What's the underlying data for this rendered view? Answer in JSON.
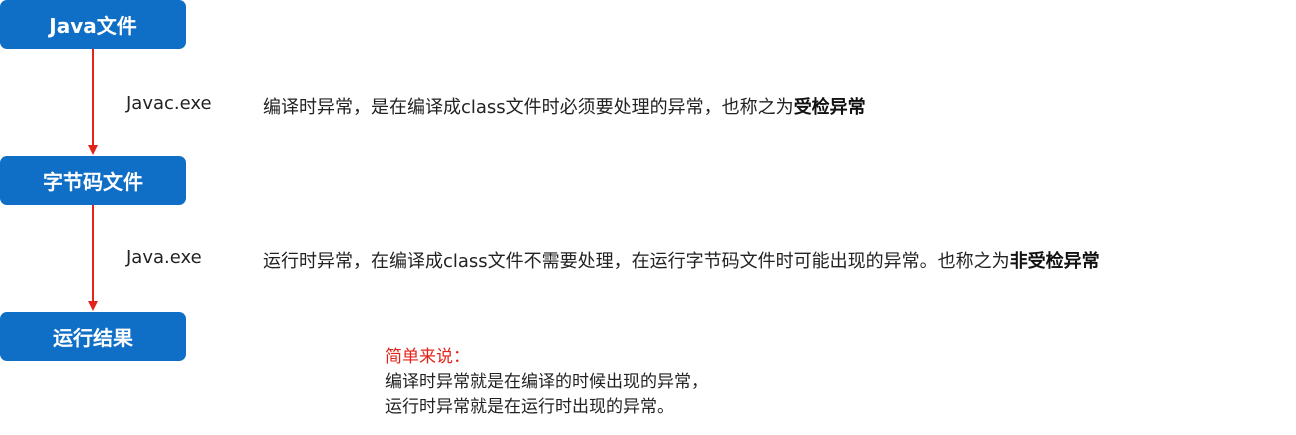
{
  "stages": [
    {
      "label": "Java文件"
    },
    {
      "label": "字节码文件"
    },
    {
      "label": "运行结果"
    }
  ],
  "transitions": [
    {
      "tool": "Javac.exe",
      "description": "编译时异常，是在编译成class文件时必须要处理的异常，也称之为",
      "emphasis": "受检异常"
    },
    {
      "tool": "Java.exe",
      "description": "运行时异常，在编译成class文件不需要处理，在运行字节码文件时可能出现的异常。也称之为",
      "emphasis": "非受检异常"
    }
  ],
  "summary": {
    "heading": "简单来说：",
    "lines": [
      "编译时异常就是在编译的时候出现的异常，",
      "运行时异常就是在运行时出现的异常。"
    ]
  },
  "colors": {
    "box": "#0f6ec6",
    "arrow": "#e3241b",
    "heading": "#e3241b"
  }
}
